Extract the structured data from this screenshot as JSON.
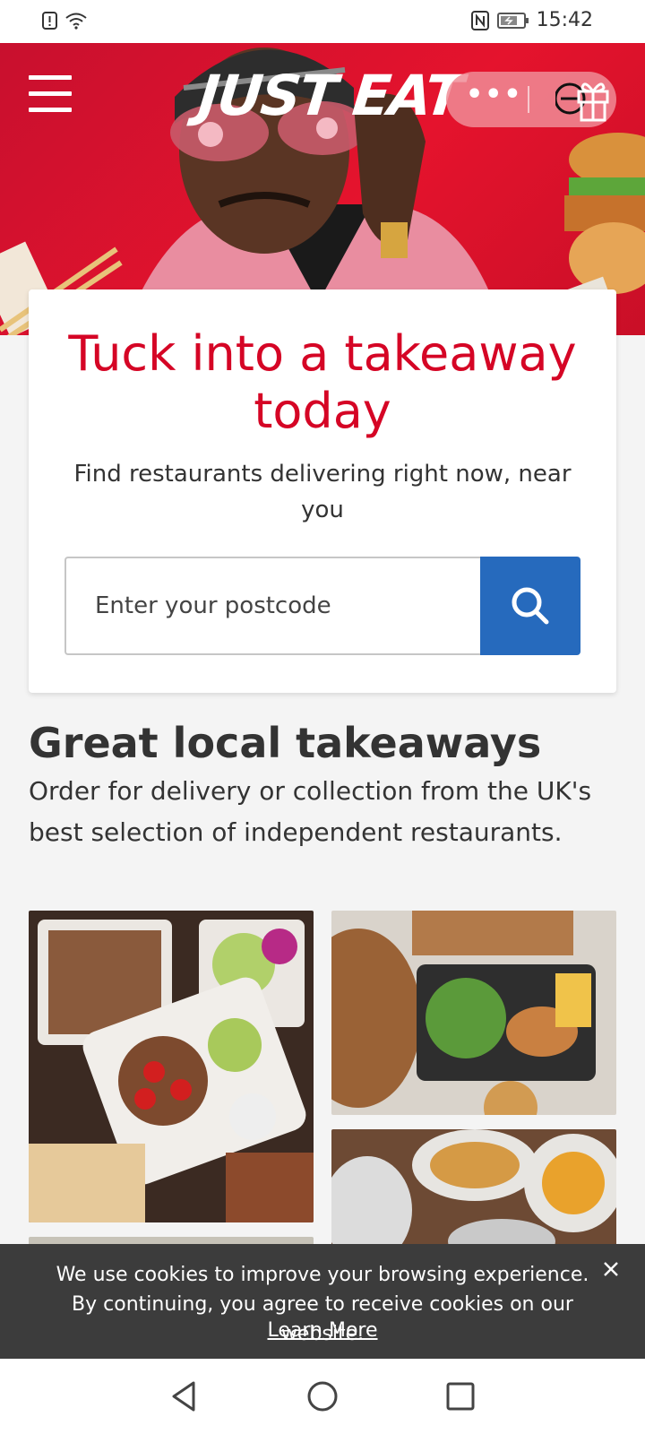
{
  "status_bar": {
    "time": "15:42"
  },
  "header": {
    "brand": "JUST EAT",
    "more_icon": "more-dots-icon",
    "gift_icon": "gift-icon",
    "brand_color": "#d50525"
  },
  "search_card": {
    "title": "Tuck into a takeaway today",
    "subtitle": "Find restaurants delivering right now, near you",
    "postcode_placeholder": "Enter your postcode",
    "postcode_value": "",
    "button_color": "#266abd",
    "search_icon": "search-icon"
  },
  "section": {
    "title": "Great local takeaways",
    "description": "Order for delivery or collection from the UK's best selection of independent restaurants."
  },
  "cookie_banner": {
    "text": "We use cookies to improve your browsing experience. By continuing, you agree to receive cookies on our website.",
    "link": "Learn More",
    "close_icon": "close-icon"
  },
  "nav_bar": {
    "back_icon": "back-triangle-icon",
    "home_icon": "home-circle-icon",
    "recents_icon": "recents-square-icon"
  }
}
